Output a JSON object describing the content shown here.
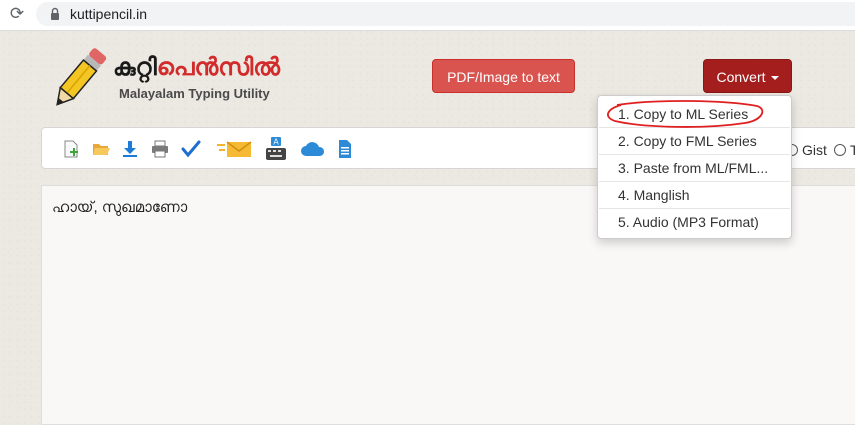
{
  "browser": {
    "url": "kuttipencil.in"
  },
  "logo": {
    "title_black": "കുറ്റി",
    "title_red": "പെൻസിൽ",
    "subtitle": "Malayalam Typing Utility"
  },
  "header": {
    "pdf_button": "PDF/Image to text",
    "convert_button": "Convert"
  },
  "toolbar": {
    "icons": [
      "new-file-icon",
      "open-folder-icon",
      "download-icon",
      "print-icon",
      "spellcheck-icon",
      "email-icon",
      "keyboard-icon",
      "cloud-icon",
      "document-icon"
    ],
    "radio_gist": "Gist",
    "radio_partial": "T"
  },
  "editor": {
    "content": "ഹായ്, സുഖമാണോ"
  },
  "convert_menu": {
    "items": [
      "1. Copy to ML Series",
      "2. Copy to FML Series",
      "3. Paste from ML/FML...",
      "4. Manglish",
      "5. Audio (MP3 Format)"
    ]
  },
  "colors": {
    "pdf_button": "#d9534f",
    "convert_button": "#a51e1e",
    "annotation": "#e02020"
  }
}
